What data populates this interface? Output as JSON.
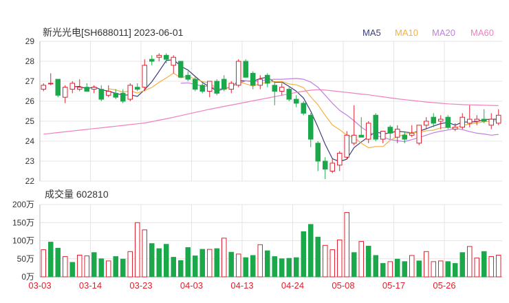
{
  "header": {
    "title": "新光光电[SH688011] 2023-06-01",
    "legend": [
      {
        "label": "MA5",
        "color": "#3d3d7a"
      },
      {
        "label": "MA10",
        "color": "#f5b041"
      },
      {
        "label": "MA20",
        "color": "#c27ee0"
      },
      {
        "label": "MA60",
        "color": "#f07fc0"
      }
    ]
  },
  "volume_header": {
    "label": "成交量 602810"
  },
  "colors": {
    "up": "#e0202e",
    "down": "#1aa84a",
    "grid": "#e4e4e4",
    "axis": "#333333",
    "date_label": "#e0202e"
  },
  "chart_data": [
    {
      "type": "candlestick",
      "title": "新光光电[SH688011] 2023-06-01",
      "ylim": [
        22,
        29
      ],
      "y_ticks": [
        "29",
        "28",
        "27",
        "26",
        "25",
        "24",
        "23",
        "22"
      ],
      "x_labels": [
        "03-03",
        "03-14",
        "03-23",
        "04-03",
        "04-13",
        "04-24",
        "05-08",
        "05-17",
        "05-26"
      ],
      "x_label_positions": [
        0,
        7,
        14,
        21,
        28,
        35,
        42,
        49,
        56
      ],
      "ohlc": [
        [
          26.6,
          26.9,
          26.5,
          26.8
        ],
        [
          26.9,
          27.4,
          26.8,
          26.9
        ],
        [
          27.1,
          27.1,
          26.2,
          26.3
        ],
        [
          26.2,
          26.8,
          25.9,
          26.7
        ],
        [
          26.6,
          27.0,
          26.4,
          26.9
        ],
        [
          26.6,
          27.1,
          26.5,
          26.7
        ],
        [
          26.7,
          26.9,
          26.5,
          26.5
        ],
        [
          26.6,
          26.8,
          26.4,
          26.7
        ],
        [
          26.6,
          26.8,
          26.0,
          26.1
        ],
        [
          26.3,
          26.8,
          26.2,
          26.5
        ],
        [
          26.4,
          26.6,
          26.1,
          26.2
        ],
        [
          26.4,
          26.6,
          25.9,
          26.0
        ],
        [
          26.1,
          26.9,
          26.0,
          26.8
        ],
        [
          26.7,
          26.9,
          26.5,
          26.6
        ],
        [
          26.7,
          28.1,
          26.5,
          27.8
        ],
        [
          28.1,
          28.3,
          27.8,
          28.0
        ],
        [
          28.2,
          28.4,
          28.0,
          28.3
        ],
        [
          28.3,
          28.4,
          27.9,
          28.1
        ],
        [
          27.8,
          28.3,
          27.4,
          28.2
        ],
        [
          28.0,
          28.0,
          27.2,
          27.2
        ],
        [
          27.3,
          27.5,
          27.0,
          27.1
        ],
        [
          27.1,
          27.2,
          26.5,
          26.6
        ],
        [
          26.8,
          26.9,
          26.4,
          26.5
        ],
        [
          26.5,
          27.0,
          26.2,
          27.0
        ],
        [
          27.0,
          27.1,
          26.3,
          26.4
        ],
        [
          27.1,
          27.3,
          26.5,
          26.6
        ],
        [
          26.6,
          27.0,
          26.4,
          26.9
        ],
        [
          26.8,
          28.1,
          26.7,
          28.0
        ],
        [
          28.0,
          28.1,
          27.4,
          27.2
        ],
        [
          27.4,
          27.5,
          26.6,
          26.8
        ],
        [
          26.8,
          27.3,
          26.6,
          27.1
        ],
        [
          27.3,
          27.4,
          26.7,
          26.9
        ],
        [
          26.8,
          27.0,
          25.8,
          26.5
        ],
        [
          26.5,
          26.9,
          26.3,
          26.7
        ],
        [
          26.6,
          26.7,
          26.0,
          26.1
        ],
        [
          26.1,
          26.3,
          25.7,
          25.9
        ],
        [
          25.9,
          26.0,
          25.3,
          25.4
        ],
        [
          25.3,
          25.4,
          23.7,
          24.1
        ],
        [
          23.9,
          24.0,
          22.5,
          23.0
        ],
        [
          23.0,
          23.2,
          22.1,
          22.6
        ],
        [
          22.5,
          23.1,
          22.4,
          22.9
        ],
        [
          22.8,
          23.5,
          22.5,
          23.4
        ],
        [
          23.2,
          24.5,
          23.1,
          24.3
        ],
        [
          23.9,
          25.8,
          23.8,
          24.3
        ],
        [
          24.3,
          25.2,
          24.2,
          24.2
        ],
        [
          24.1,
          25.0,
          23.9,
          24.9
        ],
        [
          25.3,
          25.4,
          24.0,
          24.1
        ],
        [
          24.1,
          24.5,
          23.9,
          24.5
        ],
        [
          24.7,
          24.8,
          24.1,
          24.4
        ],
        [
          24.2,
          24.8,
          23.9,
          24.6
        ],
        [
          24.3,
          24.5,
          23.9,
          24.1
        ],
        [
          24.3,
          24.8,
          24.2,
          24.4
        ],
        [
          23.9,
          24.7,
          23.8,
          24.8
        ],
        [
          24.8,
          25.2,
          24.6,
          25.0
        ],
        [
          25.2,
          25.4,
          24.7,
          24.9
        ],
        [
          25.0,
          25.3,
          24.6,
          25.1
        ],
        [
          25.2,
          25.3,
          24.6,
          24.7
        ],
        [
          24.6,
          24.9,
          24.5,
          24.7
        ],
        [
          24.7,
          25.4,
          24.6,
          25.2
        ],
        [
          24.9,
          25.8,
          24.7,
          25.1
        ],
        [
          25.0,
          25.3,
          24.8,
          25.1
        ],
        [
          25.1,
          25.6,
          24.9,
          25.0
        ],
        [
          24.8,
          25.4,
          24.6,
          25.1
        ],
        [
          24.9,
          25.6,
          24.8,
          25.3
        ]
      ],
      "series": [
        {
          "name": "MA5",
          "values": [
            null,
            null,
            null,
            null,
            26.72,
            26.74,
            26.62,
            26.72,
            26.58,
            26.5,
            26.4,
            26.3,
            26.32,
            26.24,
            26.58,
            26.98,
            27.5,
            28.04,
            28.08,
            27.76,
            27.56,
            27.24,
            26.94,
            26.72,
            26.52,
            26.62,
            26.72,
            27.02,
            27.02,
            27.0,
            27.14,
            27.2,
            26.94,
            26.96,
            26.74,
            26.5,
            26.16,
            25.5,
            24.7,
            23.84,
            23.12,
            22.98,
            23.1,
            23.68,
            23.96,
            24.22,
            24.48,
            24.36,
            24.42,
            24.5,
            24.46,
            24.42,
            24.5,
            24.62,
            24.76,
            24.88,
            24.94,
            24.8,
            24.96,
            24.96,
            24.98,
            25.08,
            25.1,
            25.1
          ]
        },
        {
          "name": "MA10",
          "values": [
            null,
            null,
            null,
            null,
            null,
            null,
            null,
            null,
            null,
            26.62,
            26.57,
            26.46,
            26.52,
            26.41,
            26.54,
            26.69,
            26.95,
            27.17,
            27.41,
            27.17,
            27.27,
            27.11,
            26.99,
            26.9,
            26.64,
            26.59,
            26.73,
            26.98,
            26.87,
            26.76,
            26.88,
            26.96,
            26.98,
            26.99,
            26.87,
            26.82,
            26.68,
            26.22,
            25.82,
            25.29,
            24.81,
            24.57,
            24.3,
            24.19,
            23.9,
            23.67,
            23.73,
            23.73,
            24.05,
            24.23,
            24.34,
            24.45,
            24.43,
            24.52,
            24.55,
            24.67,
            24.68,
            24.66,
            24.79,
            24.86,
            24.91,
            24.98,
            25.01,
            25.04
          ]
        },
        {
          "name": "MA20",
          "values": [
            null,
            null,
            null,
            null,
            null,
            null,
            null,
            null,
            null,
            null,
            null,
            null,
            null,
            null,
            null,
            null,
            null,
            null,
            null,
            26.9,
            26.92,
            26.84,
            26.76,
            26.74,
            26.61,
            26.64,
            26.72,
            26.9,
            27.02,
            26.98,
            27.02,
            27.08,
            27.1,
            27.1,
            27.12,
            27.14,
            27.1,
            26.96,
            26.7,
            26.3,
            25.9,
            25.54,
            25.3,
            25.02,
            24.7,
            24.46,
            24.28,
            24.2,
            24.08,
            24.02,
            23.98,
            24.08,
            24.18,
            24.3,
            24.42,
            24.5,
            24.56,
            24.64,
            24.58,
            24.48,
            24.4,
            24.36,
            24.3,
            24.34
          ]
        },
        {
          "name": "MA60",
          "values": [
            24.35,
            24.39,
            24.43,
            24.47,
            24.51,
            24.55,
            24.59,
            24.63,
            24.67,
            24.71,
            24.75,
            24.79,
            24.83,
            24.87,
            24.91,
            24.98,
            25.05,
            25.12,
            25.2,
            25.28,
            25.36,
            25.44,
            25.52,
            25.6,
            25.67,
            25.74,
            25.81,
            25.88,
            25.95,
            26.02,
            26.09,
            26.16,
            26.23,
            26.3,
            26.37,
            26.44,
            26.5,
            26.55,
            26.58,
            26.56,
            26.52,
            26.48,
            26.44,
            26.4,
            26.36,
            26.32,
            26.27,
            26.22,
            26.17,
            26.12,
            26.08,
            26.04,
            26.0,
            25.96,
            25.93,
            25.9,
            25.87,
            25.85,
            25.83,
            25.82,
            25.81,
            25.8,
            25.79,
            25.78
          ]
        }
      ]
    },
    {
      "type": "bar",
      "title": "成交量 602810",
      "ylim": [
        0,
        2000000
      ],
      "y_ticks": [
        "200万",
        "150万",
        "100万",
        "50万",
        "0万"
      ],
      "values": [
        750000,
        960000,
        790000,
        560000,
        400000,
        600000,
        580000,
        670000,
        500000,
        440000,
        560000,
        490000,
        700000,
        1500000,
        1300000,
        920000,
        780000,
        900000,
        540000,
        450000,
        810000,
        580000,
        760000,
        760000,
        780000,
        1070000,
        680000,
        630000,
        530000,
        590000,
        890000,
        720000,
        560000,
        500000,
        510000,
        530000,
        1250000,
        1450000,
        1100000,
        870000,
        750000,
        1020000,
        1780000,
        670000,
        980000,
        850000,
        590000,
        370000,
        420000,
        490000,
        420000,
        590000,
        440000,
        700000,
        420000,
        440000,
        420000,
        370000,
        670000,
        840000,
        520000,
        700000,
        560000,
        600000
      ],
      "up": [
        true,
        false,
        false,
        true,
        false,
        true,
        true,
        false,
        false,
        true,
        false,
        false,
        true,
        true,
        true,
        false,
        false,
        false,
        false,
        false,
        false,
        false,
        false,
        true,
        false,
        true,
        false,
        true,
        false,
        false,
        true,
        false,
        false,
        false,
        false,
        false,
        false,
        false,
        false,
        true,
        true,
        true,
        true,
        false,
        true,
        false,
        false,
        false,
        true,
        false,
        false,
        true,
        false,
        true,
        true,
        true,
        false,
        false,
        false,
        true,
        true,
        false,
        true,
        true
      ]
    }
  ]
}
